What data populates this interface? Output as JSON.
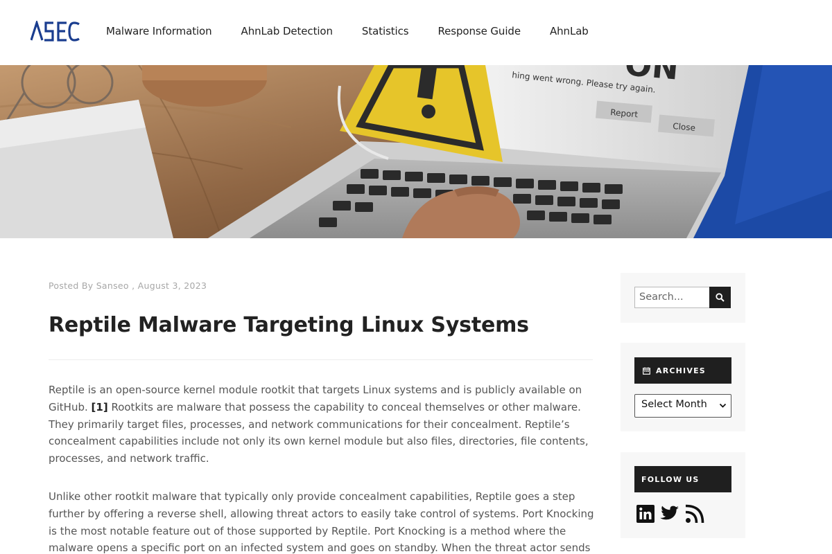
{
  "header": {
    "logo_text": "ASEC",
    "nav": [
      {
        "label": "Malware Information"
      },
      {
        "label": "AhnLab Detection"
      },
      {
        "label": "Statistics"
      },
      {
        "label": "Response Guide"
      },
      {
        "label": "AhnLab"
      }
    ]
  },
  "hero": {
    "dialog_text_top": "ON",
    "dialog_message": "hing went wrong. Please try again.",
    "report_button": "Report",
    "close_button": "Close"
  },
  "post": {
    "meta": "Posted By Sanseo , August 3, 2023",
    "title": "Reptile Malware Targeting Linux Systems",
    "p1_a": "Reptile is an open-source kernel module rootkit that targets Linux systems and is publicly available on GitHub. ",
    "p1_ref": "[1]",
    "p1_b": " Rootkits are malware that possess the capability to conceal themselves or other malware. They primarily target files, processes, and network communications for their concealment. Reptile’s concealment capabilities include not only its own kernel module but also files, directories, file contents, processes, and network traffic.",
    "p2": "Unlike other rootkit malware that typically only provide concealment capabilities, Reptile goes a step further by offering a reverse shell, allowing threat actors to easily take control of systems. Port Knocking is the most notable feature out of those supported by Reptile. Port Knocking is a method where the malware opens a specific port on an infected system and goes on standby. When the threat actor sends a Magic Packet to the"
  },
  "sidebar": {
    "search_placeholder": "Search...",
    "archives_title": "ARCHIVES",
    "archives_select": "Select Month",
    "follow_title": "FOLLOW US",
    "social_icons": [
      "linkedin-icon",
      "twitter-icon",
      "rss-icon"
    ]
  },
  "colors": {
    "brand": "#1a3d8f",
    "dark": "#1f1f1f",
    "widget_bg": "#f7f7f7"
  }
}
